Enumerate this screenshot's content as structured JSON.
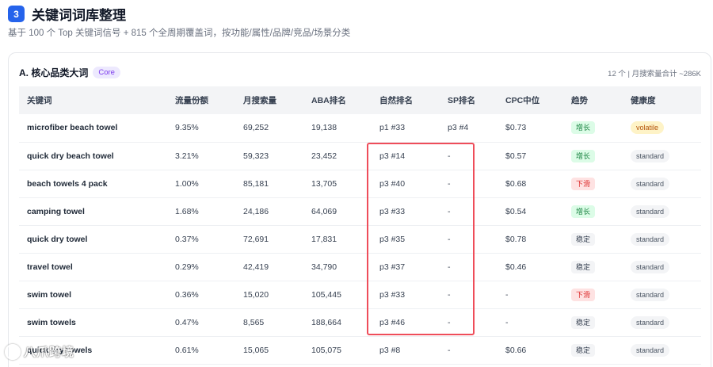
{
  "header": {
    "step_number": "3",
    "title": "关键词词库整理",
    "subtitle": "基于 100 个 Top 关键词信号 + 815 个全周期覆盖词，按功能/属性/品牌/竞品/场景分类"
  },
  "section": {
    "title": "A. 核心品类大词",
    "tag": "Core",
    "summary": "12 个 | 月搜索量合计 ~286K"
  },
  "table": {
    "columns": [
      "关键词",
      "流量份额",
      "月搜索量",
      "ABA排名",
      "自然排名",
      "SP排名",
      "CPC中位",
      "趋势",
      "健康度"
    ],
    "rows": [
      {
        "keyword": "microfiber beach towel",
        "share": "9.35%",
        "volume": "69,252",
        "aba": "19,138",
        "organic": "p1 #33",
        "sp": "p3 #4",
        "cpc": "$0.73",
        "trend": "增长",
        "trend_type": "up",
        "health": "volatile"
      },
      {
        "keyword": "quick dry beach towel",
        "share": "3.21%",
        "volume": "59,323",
        "aba": "23,452",
        "organic": "p3 #14",
        "sp": "-",
        "cpc": "$0.57",
        "trend": "增长",
        "trend_type": "up",
        "health": "standard"
      },
      {
        "keyword": "beach towels 4 pack",
        "share": "1.00%",
        "volume": "85,181",
        "aba": "13,705",
        "organic": "p3 #40",
        "sp": "-",
        "cpc": "$0.68",
        "trend": "下滑",
        "trend_type": "down",
        "health": "standard"
      },
      {
        "keyword": "camping towel",
        "share": "1.68%",
        "volume": "24,186",
        "aba": "64,069",
        "organic": "p3 #33",
        "sp": "-",
        "cpc": "$0.54",
        "trend": "增长",
        "trend_type": "up",
        "health": "standard"
      },
      {
        "keyword": "quick dry towel",
        "share": "0.37%",
        "volume": "72,691",
        "aba": "17,831",
        "organic": "p3 #35",
        "sp": "-",
        "cpc": "$0.78",
        "trend": "稳定",
        "trend_type": "flat",
        "health": "standard"
      },
      {
        "keyword": "travel towel",
        "share": "0.29%",
        "volume": "42,419",
        "aba": "34,790",
        "organic": "p3 #37",
        "sp": "-",
        "cpc": "$0.46",
        "trend": "稳定",
        "trend_type": "flat",
        "health": "standard"
      },
      {
        "keyword": "swim towel",
        "share": "0.36%",
        "volume": "15,020",
        "aba": "105,445",
        "organic": "p3 #33",
        "sp": "-",
        "cpc": "-",
        "trend": "下滑",
        "trend_type": "down",
        "health": "standard"
      },
      {
        "keyword": "swim towels",
        "share": "0.47%",
        "volume": "8,565",
        "aba": "188,664",
        "organic": "p3 #46",
        "sp": "-",
        "cpc": "-",
        "trend": "稳定",
        "trend_type": "flat",
        "health": "standard"
      },
      {
        "keyword": "quick dry towels",
        "share": "0.61%",
        "volume": "15,065",
        "aba": "105,075",
        "organic": "p3 #8",
        "sp": "-",
        "cpc": "$0.66",
        "trend": "稳定",
        "trend_type": "flat",
        "health": "standard"
      }
    ]
  },
  "colors": {
    "accent": "#2563eb",
    "highlight": "#ef4d5a",
    "trend_up": "#15803d",
    "trend_down": "#dc2626"
  },
  "watermark": {
    "text": "八爪跨境",
    "icon": "swirl-logo-icon"
  }
}
